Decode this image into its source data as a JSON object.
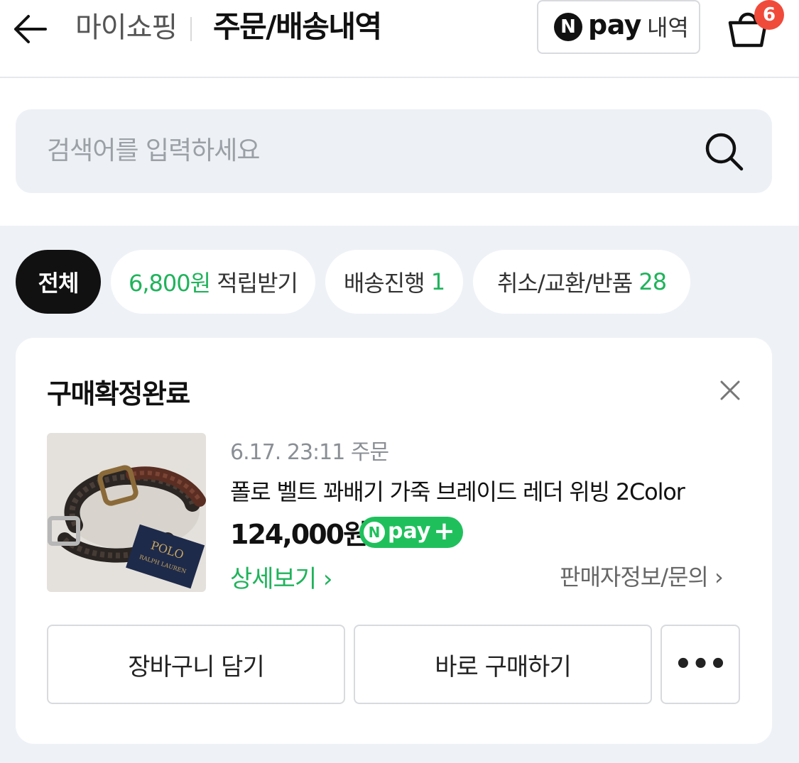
{
  "header": {
    "crumb": "마이쇼핑",
    "title": "주문/배송내역",
    "npay_logo": "N",
    "npay_word": "pay",
    "npay_history": "내역",
    "cart_count": "6"
  },
  "search": {
    "placeholder": "검색어를 입력하세요"
  },
  "chips": {
    "all": "전체",
    "points_amount": "6,800원",
    "points_label": " 적립받기",
    "delivery_label": "배송진행 ",
    "delivery_count": "1",
    "cancel_label": "취소/교환/반품 ",
    "cancel_count": "28"
  },
  "order": {
    "status": "구매확정완료",
    "date": "6.17. 23:11 주문",
    "product_name": "폴로 벨트 꽈배기 가죽 브레이드 레더 위빙 2Color",
    "price": "124,000원",
    "npay_plus_n": "N",
    "npay_plus_word": "pay",
    "npay_plus_sign": "+",
    "detail_link": "상세보기 ›",
    "seller_link": "판매자정보/문의 ›",
    "btn_cart": "장바구니 담기",
    "btn_buy": "바로 구매하기",
    "btn_more": "•••",
    "thumb_tag_brand": "POLO",
    "thumb_tag_sub": "RALPH LAUREN"
  },
  "colors": {
    "accent_green": "#1fb35b",
    "badge_red": "#f04a3b",
    "bg_grey": "#eef2f6"
  }
}
